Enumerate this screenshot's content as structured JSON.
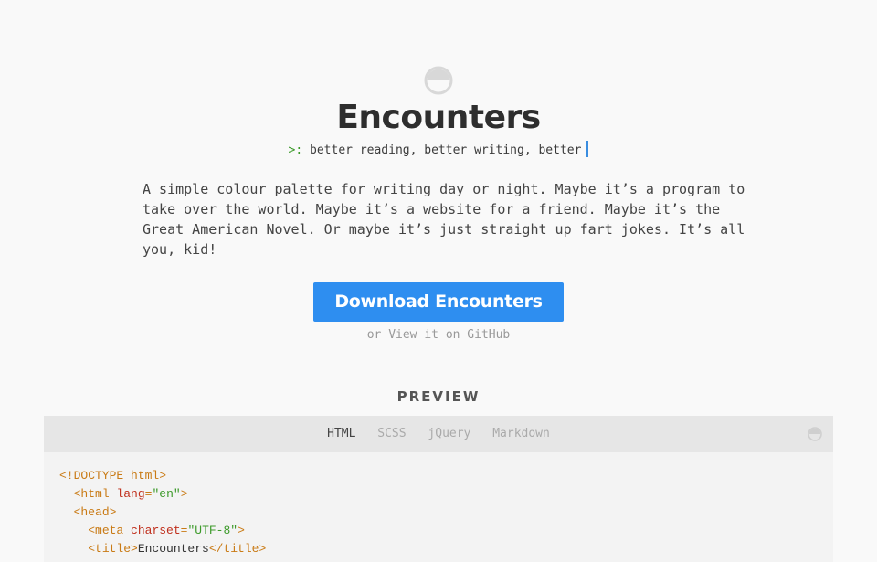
{
  "header": {
    "title": "Encounters",
    "tagline_prompt": ">:",
    "tagline_text": "better reading, better writing, better"
  },
  "intro": "A simple colour palette for writing day or night. Maybe it’s a program to take over the world. Maybe it’s a website for a friend. Maybe it’s the Great American Novel. Or maybe it’s just straight up fart jokes. It’s all you, kid!",
  "download": {
    "label": "Download Encounters",
    "or_text": "or",
    "github_link": "View it on GitHub"
  },
  "preview": {
    "heading": "PREVIEW",
    "tabs": [
      "HTML",
      "SCSS",
      "jQuery",
      "Markdown"
    ],
    "active_tab": "HTML"
  },
  "code": {
    "line1": "<!DOCTYPE html>",
    "line2_tag_open": "<html",
    "line2_attr": "lang",
    "line2_eq": "=",
    "line2_val": "\"en\"",
    "line2_close": ">",
    "line3": "<head>",
    "line4_tag_open": "<meta",
    "line4_attr": "charset",
    "line4_eq": "=",
    "line4_val": "\"UTF-8\"",
    "line4_close": ">",
    "line5_open": "<title>",
    "line5_text": "Encounters",
    "line5_close": "</title>"
  },
  "icons": {
    "logo": "half-circle-logo-icon",
    "theme_toggle": "half-circle-toggle-icon"
  },
  "colors": {
    "accent": "#2e8ef0",
    "prompt": "#3c9a2a",
    "tag": "#c97a14",
    "attr": "#c0301d",
    "string": "#3c9a2a"
  }
}
